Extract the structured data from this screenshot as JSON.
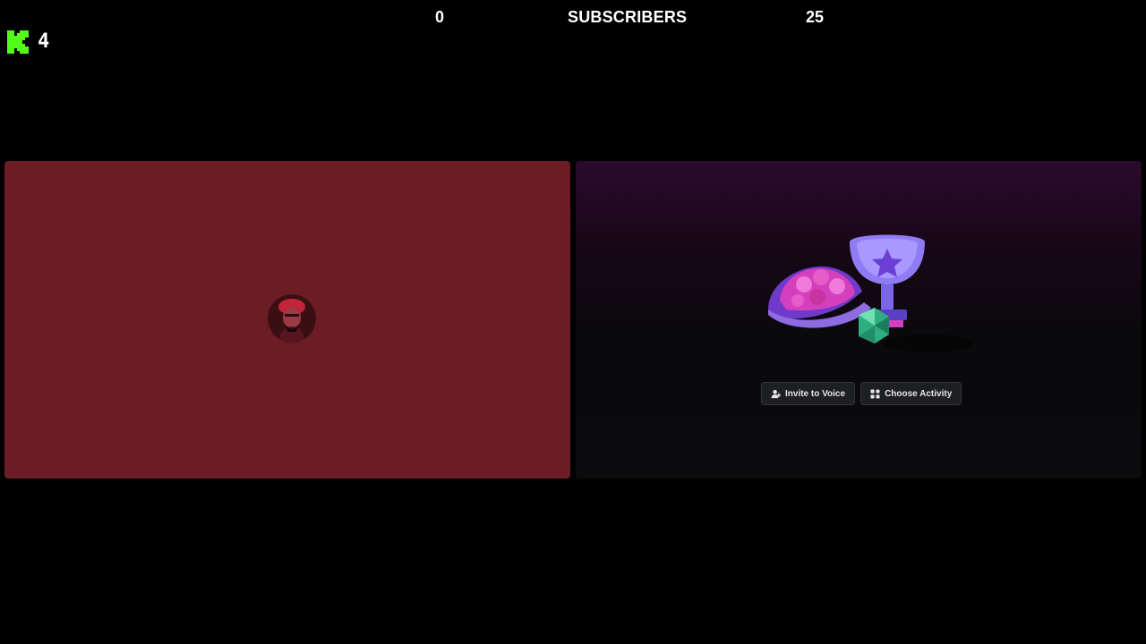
{
  "subscriber_goal": {
    "current": "0",
    "label": "SUBSCRIBERS",
    "target": "25"
  },
  "kick_badge": {
    "icon": "kick-logo-icon",
    "count": "4",
    "color": "#53fc18"
  },
  "participant_tile": {
    "background": "#6b1c24",
    "avatar_icon": "user-avatar"
  },
  "activity_tile": {
    "art_icon": "activity-trophy-illustration",
    "buttons": [
      {
        "label": "Invite to Voice",
        "icon": "add-person-icon"
      },
      {
        "label": "Choose Activity",
        "icon": "activity-grid-icon"
      }
    ]
  }
}
